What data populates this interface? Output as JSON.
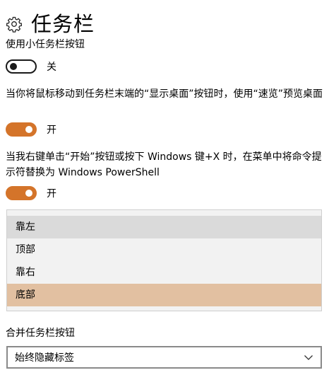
{
  "page": {
    "title": "任务栏"
  },
  "settings": {
    "small_buttons": {
      "label": "使用小任务栏按钮",
      "state_text": "关",
      "on": false
    },
    "peek": {
      "label": "当你将鼠标移动到任务栏末端的“显示桌面”按钮时，使用“速览”预览桌面",
      "state_text": "开",
      "on": true
    },
    "powershell": {
      "label": "当我右键单击“开始”按钮或按下 Windows 键+X 时，在菜单中将命令提示符替换为 Windows PowerShell",
      "state_text": "开",
      "on": true
    }
  },
  "location_dropdown": {
    "options": [
      "靠左",
      "顶部",
      "靠右",
      "底部"
    ],
    "hovered": "靠左",
    "selected": "底部"
  },
  "combine": {
    "label": "合并任务栏按钮",
    "value": "始终隐藏标签"
  },
  "colors": {
    "accent": "#d4742a",
    "selected_option": "#e2c0a1",
    "hover_option": "#dadada",
    "panel": "#f2f2f2"
  },
  "icons": {
    "settings": "gear-icon",
    "dropdown": "chevron-down-icon"
  }
}
